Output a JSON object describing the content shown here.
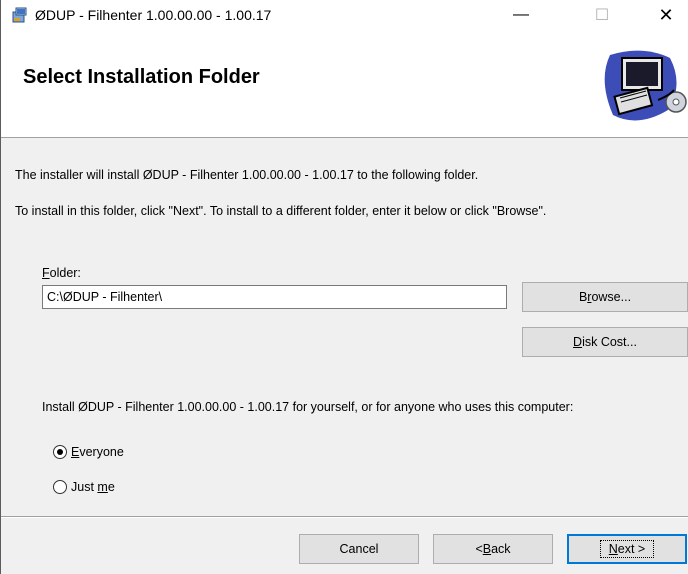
{
  "window": {
    "title": "ØDUP - Filhenter 1.00.00.00 - 1.00.17",
    "minimize_glyph": "—",
    "maximize_glyph": "☐",
    "close_glyph": "✕"
  },
  "banner": {
    "title": "Select Installation Folder"
  },
  "body": {
    "line1": "The installer will install ØDUP - Filhenter 1.00.00.00 - 1.00.17 to the following folder.",
    "line2": "To install in this folder, click \"Next\". To install to a different folder, enter it below or click \"Browse\".",
    "folder_label_accel": "F",
    "folder_label_rest": "older:",
    "folder_value": "C:\\ØDUP - Filhenter\\",
    "browse_pre": "B",
    "browse_accel": "r",
    "browse_rest": "owse...",
    "diskcost_accel": "D",
    "diskcost_rest": "isk Cost...",
    "install_for": "Install ØDUP - Filhenter 1.00.00.00 - 1.00.17 for yourself, or for anyone who uses this computer:",
    "radio_everyone_accel": "E",
    "radio_everyone_rest": "veryone",
    "radio_justme_pre": "Just ",
    "radio_justme_accel": "m",
    "radio_justme_rest": "e"
  },
  "footer": {
    "cancel": "Cancel",
    "back_pre": "< ",
    "back_accel": "B",
    "back_rest": "ack",
    "next_accel": "N",
    "next_rest": "ext >"
  }
}
